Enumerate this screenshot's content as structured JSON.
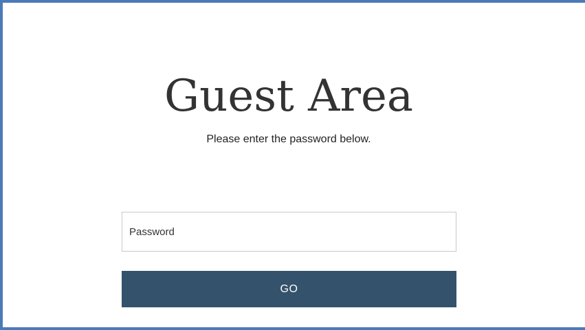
{
  "page": {
    "title": "Guest Area",
    "subtitle": "Please enter the password below."
  },
  "form": {
    "password": {
      "placeholder": "Password",
      "value": ""
    },
    "submit_label": "GO"
  },
  "colors": {
    "frame_border": "#4a7ab8",
    "button_background": "#34526b",
    "button_text": "#ffffff",
    "title_text": "#333333"
  }
}
